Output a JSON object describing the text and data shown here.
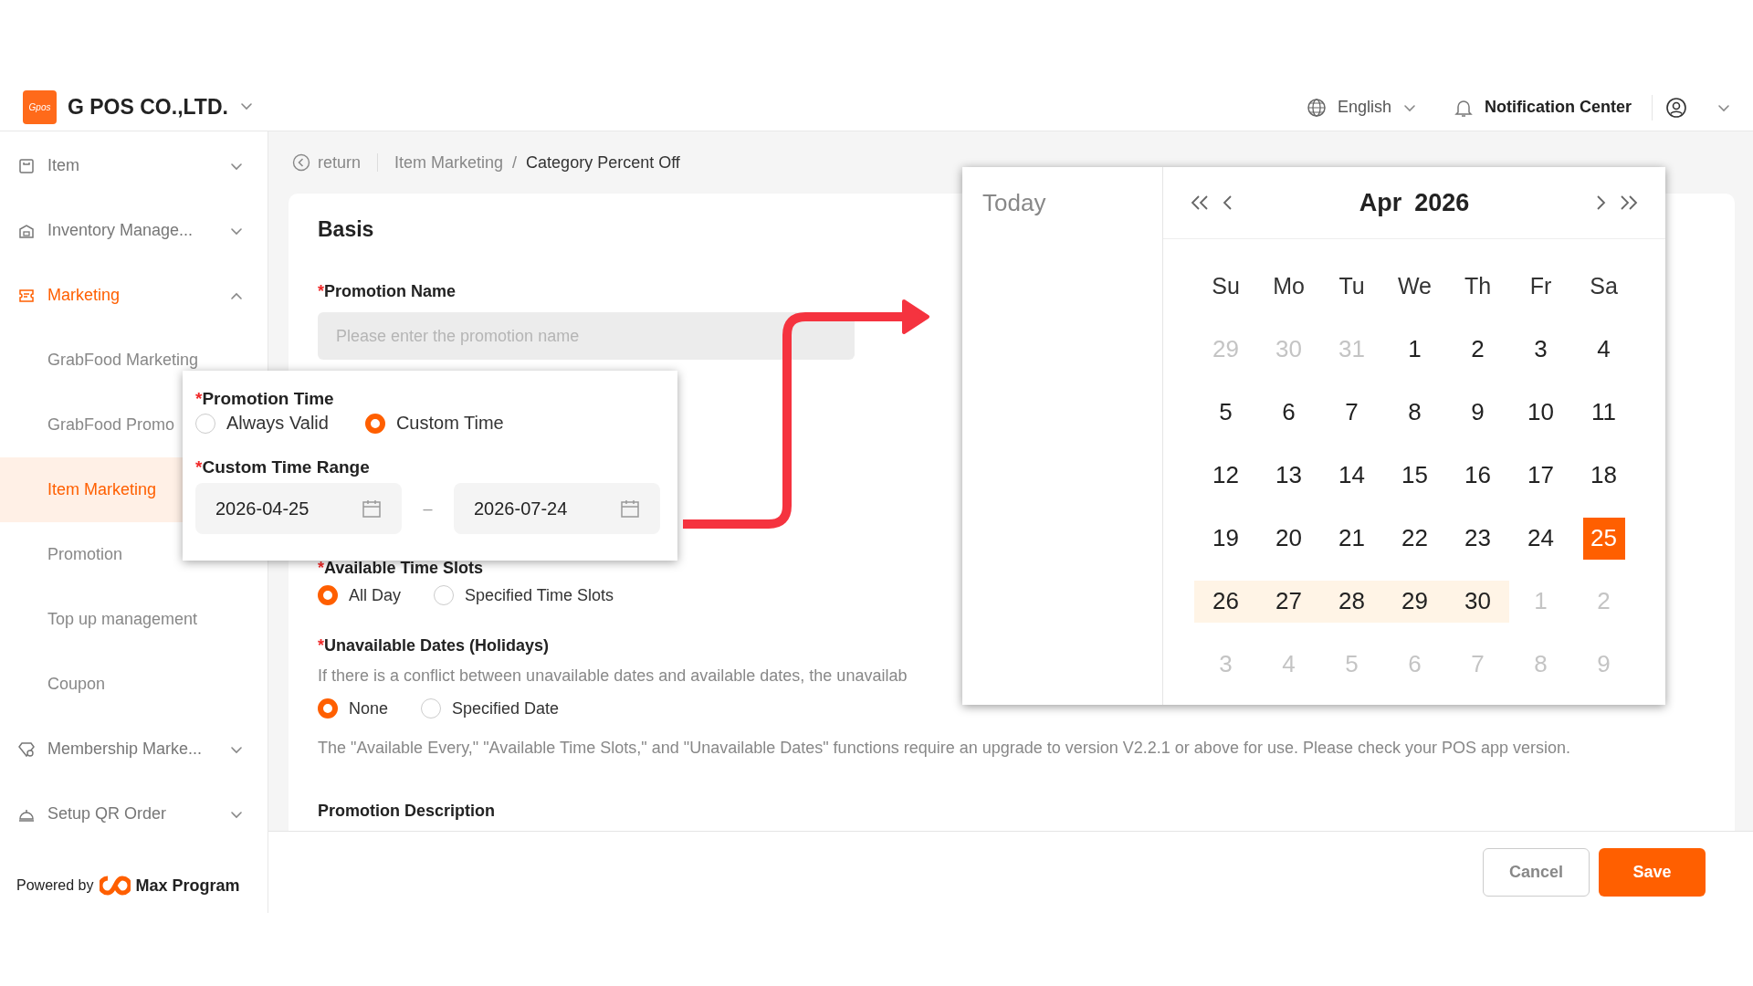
{
  "header": {
    "logo_text": "Gpos",
    "company": "G POS CO.,LTD.",
    "language": "English",
    "notification": "Notification Center"
  },
  "sidebar": {
    "items": [
      {
        "label": "Item",
        "selected": false,
        "expanded": false
      },
      {
        "label": "Inventory Manage...",
        "selected": false,
        "expanded": false
      },
      {
        "label": "Marketing",
        "selected": true,
        "expanded": true,
        "children": [
          {
            "label": "GrabFood Marketing",
            "selected": false
          },
          {
            "label": "GrabFood Promo",
            "selected": false
          },
          {
            "label": "Item Marketing",
            "selected": true
          },
          {
            "label": "Promotion",
            "selected": false
          },
          {
            "label": "Top up management",
            "selected": false
          },
          {
            "label": "Coupon",
            "selected": false
          }
        ]
      },
      {
        "label": "Membership Marke...",
        "selected": false,
        "expanded": false
      },
      {
        "label": "Setup QR Order",
        "selected": false,
        "expanded": false
      }
    ],
    "powered_by": "Powered by",
    "brand": "Max Program"
  },
  "breadcrumb": {
    "back": "return",
    "items": [
      "Item Marketing",
      "Category Percent Off"
    ],
    "separator": "/"
  },
  "form": {
    "section": "Basis",
    "promotion_name": {
      "mark": "*",
      "label": "Promotion Name",
      "placeholder": "Please enter the promotion name"
    },
    "time_slots": {
      "mark": "*",
      "label": "Available Time Slots",
      "options": [
        {
          "label": "All Day",
          "selected": true
        },
        {
          "label": "Specified Time Slots",
          "selected": false
        }
      ]
    },
    "unavailable": {
      "mark": "*",
      "label": "Unavailable Dates (Holidays)",
      "hint": "If there is a conflict between unavailable dates and available dates, the unavailab",
      "options": [
        {
          "label": "None",
          "selected": true
        },
        {
          "label": "Specified Date",
          "selected": false
        }
      ]
    },
    "note": "The \"Available Every,\" \"Available Time Slots,\" and \"Unavailable Dates\" functions require an upgrade to version V2.2.1 or above for use. Please check your POS app version.",
    "description_label": "Promotion Description"
  },
  "footer": {
    "buttons": [
      {
        "label": "Cancel",
        "kind": "secondary"
      },
      {
        "label": "Save",
        "kind": "primary"
      }
    ]
  },
  "time_popup": {
    "promotion_time": {
      "mark": "*",
      "label": "Promotion Time",
      "options": [
        {
          "label": "Always Valid",
          "selected": false
        },
        {
          "label": "Custom Time",
          "selected": true
        }
      ]
    },
    "range": {
      "mark": "*",
      "label": "Custom Time Range",
      "start": "2026-04-25",
      "separator": "–",
      "end": "2026-07-24"
    }
  },
  "calendar": {
    "today": "Today",
    "month": "Apr",
    "year": "2026",
    "weekdays": [
      "Su",
      "Mo",
      "Tu",
      "We",
      "Th",
      "Fr",
      "Sa"
    ],
    "days": [
      {
        "day": "29",
        "outside": true,
        "selected": false,
        "in_range": false
      },
      {
        "day": "30",
        "outside": true,
        "selected": false,
        "in_range": false
      },
      {
        "day": "31",
        "outside": true,
        "selected": false,
        "in_range": false
      },
      {
        "day": "1",
        "outside": false,
        "selected": false,
        "in_range": false
      },
      {
        "day": "2",
        "outside": false,
        "selected": false,
        "in_range": false
      },
      {
        "day": "3",
        "outside": false,
        "selected": false,
        "in_range": false
      },
      {
        "day": "4",
        "outside": false,
        "selected": false,
        "in_range": false
      },
      {
        "day": "5",
        "outside": false,
        "selected": false,
        "in_range": false
      },
      {
        "day": "6",
        "outside": false,
        "selected": false,
        "in_range": false
      },
      {
        "day": "7",
        "outside": false,
        "selected": false,
        "in_range": false
      },
      {
        "day": "8",
        "outside": false,
        "selected": false,
        "in_range": false
      },
      {
        "day": "9",
        "outside": false,
        "selected": false,
        "in_range": false
      },
      {
        "day": "10",
        "outside": false,
        "selected": false,
        "in_range": false
      },
      {
        "day": "11",
        "outside": false,
        "selected": false,
        "in_range": false
      },
      {
        "day": "12",
        "outside": false,
        "selected": false,
        "in_range": false
      },
      {
        "day": "13",
        "outside": false,
        "selected": false,
        "in_range": false
      },
      {
        "day": "14",
        "outside": false,
        "selected": false,
        "in_range": false
      },
      {
        "day": "15",
        "outside": false,
        "selected": false,
        "in_range": false
      },
      {
        "day": "16",
        "outside": false,
        "selected": false,
        "in_range": false
      },
      {
        "day": "17",
        "outside": false,
        "selected": false,
        "in_range": false
      },
      {
        "day": "18",
        "outside": false,
        "selected": false,
        "in_range": false
      },
      {
        "day": "19",
        "outside": false,
        "selected": false,
        "in_range": false
      },
      {
        "day": "20",
        "outside": false,
        "selected": false,
        "in_range": false
      },
      {
        "day": "21",
        "outside": false,
        "selected": false,
        "in_range": false
      },
      {
        "day": "22",
        "outside": false,
        "selected": false,
        "in_range": false
      },
      {
        "day": "23",
        "outside": false,
        "selected": false,
        "in_range": false
      },
      {
        "day": "24",
        "outside": false,
        "selected": false,
        "in_range": false
      },
      {
        "day": "25",
        "outside": false,
        "selected": true,
        "in_range": false
      },
      {
        "day": "26",
        "outside": false,
        "selected": false,
        "in_range": true
      },
      {
        "day": "27",
        "outside": false,
        "selected": false,
        "in_range": true
      },
      {
        "day": "28",
        "outside": false,
        "selected": false,
        "in_range": true
      },
      {
        "day": "29",
        "outside": false,
        "selected": false,
        "in_range": true
      },
      {
        "day": "30",
        "outside": false,
        "selected": false,
        "in_range": true
      },
      {
        "day": "1",
        "outside": true,
        "selected": false,
        "in_range": false
      },
      {
        "day": "2",
        "outside": true,
        "selected": false,
        "in_range": false
      },
      {
        "day": "3",
        "outside": true,
        "selected": false,
        "in_range": false
      },
      {
        "day": "4",
        "outside": true,
        "selected": false,
        "in_range": false
      },
      {
        "day": "5",
        "outside": true,
        "selected": false,
        "in_range": false
      },
      {
        "day": "6",
        "outside": true,
        "selected": false,
        "in_range": false
      },
      {
        "day": "7",
        "outside": true,
        "selected": false,
        "in_range": false
      },
      {
        "day": "8",
        "outside": true,
        "selected": false,
        "in_range": false
      },
      {
        "day": "9",
        "outside": true,
        "selected": false,
        "in_range": false
      }
    ]
  }
}
